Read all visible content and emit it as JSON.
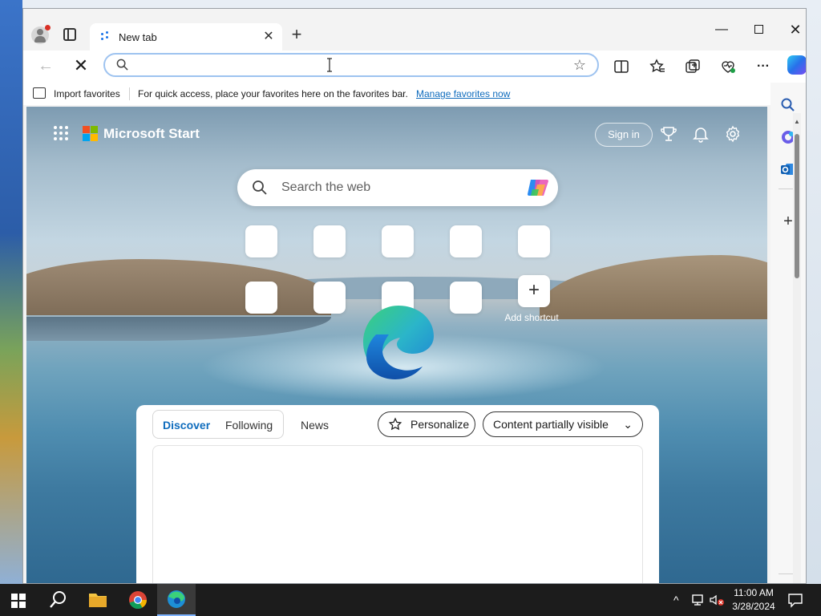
{
  "tab": {
    "title": "New tab",
    "close_glyph": "✕",
    "new_tab_glyph": "+"
  },
  "window_controls": {
    "minimize_glyph": "—",
    "close_glyph": "✕"
  },
  "toolbar": {
    "back_glyph": "←",
    "stop_glyph": "✕",
    "address_value": "",
    "favorite_glyph": "☆",
    "more_glyph": "···"
  },
  "favorites_bar": {
    "import_label": "Import favorites",
    "hint": "For quick access, place your favorites here on the favorites bar.",
    "manage_link": "Manage favorites now"
  },
  "page": {
    "brand": "Microsoft Start",
    "sign_in": "Sign in",
    "search_placeholder": "Search the web",
    "add_shortcut_glyph": "+",
    "add_shortcut_label": "Add shortcut"
  },
  "feed": {
    "tabs": [
      "Discover",
      "Following"
    ],
    "news": "News",
    "personalize": "Personalize",
    "content_visibility": "Content partially visible",
    "chevron_glyph": "⌄"
  },
  "sidebar": {
    "add_glyph": "+"
  },
  "taskbar": {
    "time": "11:00 AM",
    "date": "3/28/2024",
    "tray_chevron_glyph": "^"
  },
  "icons": [
    "profile-icon",
    "tab-actions-icon",
    "split-screen-icon",
    "favorites-icon",
    "collections-icon",
    "browser-essentials-icon",
    "copilot-icon",
    "apps-grid-icon",
    "rewards-icon",
    "bell-icon",
    "settings-icon",
    "search-icon",
    "outlook-icon",
    "edge-logo-icon"
  ],
  "colors": {
    "accent": "#0f6cbd",
    "address_focus": "#9ec3f0",
    "taskbar": "#1c1c1c"
  }
}
